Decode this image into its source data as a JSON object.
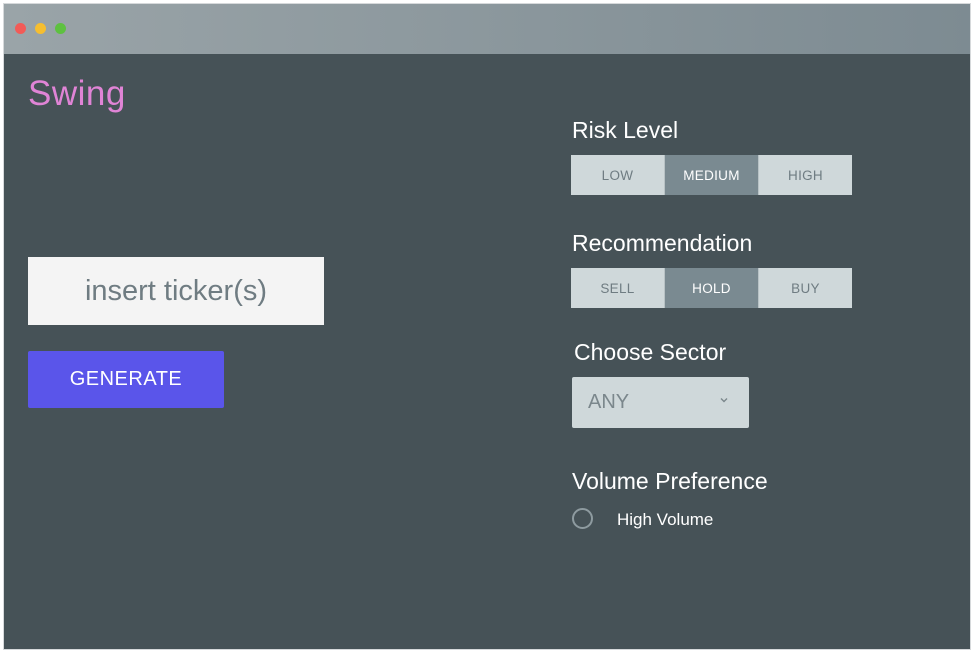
{
  "app": {
    "title": "Swing"
  },
  "ticker": {
    "placeholder": "insert ticker(s)",
    "value": ""
  },
  "actions": {
    "generate_label": "GENERATE"
  },
  "risk_level": {
    "label": "Risk Level",
    "options": [
      "LOW",
      "MEDIUM",
      "HIGH"
    ],
    "selected": "MEDIUM"
  },
  "recommendation": {
    "label": "Recommendation",
    "options": [
      "SELL",
      "HOLD",
      "BUY"
    ],
    "selected": "HOLD"
  },
  "sector": {
    "label": "Choose Sector",
    "selected": "ANY"
  },
  "volume": {
    "label": "Volume Preference",
    "option_label": "High Volume",
    "checked": false
  },
  "colors": {
    "background": "#465257",
    "title": "#e084d6",
    "accent": "#5a55ea",
    "segment": "#cfd8da",
    "segment_active": "#7a8a91"
  }
}
